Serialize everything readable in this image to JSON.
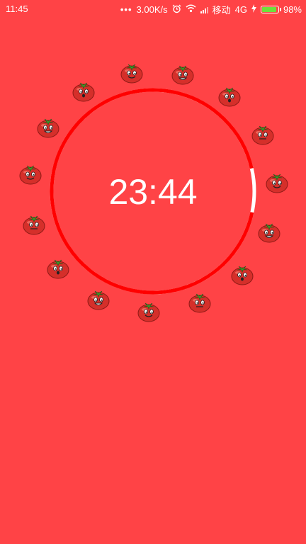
{
  "status_bar": {
    "time": "11:45",
    "network_speed": "3.00K/s",
    "carrier": "移动",
    "network_type": "4G",
    "battery_percent": "98%",
    "battery_level": 0.98,
    "icons": [
      "more-dots-icon",
      "alarm-icon",
      "wifi-icon",
      "signal-icon",
      "charging-icon",
      "battery-icon"
    ]
  },
  "timer": {
    "display": "23:44",
    "progress_remaining_fraction": 0.93
  },
  "tomatoes": {
    "count": 15,
    "icon": "tomato-face-icon"
  },
  "colors": {
    "background": "#ff4346",
    "ring": "#ff0000",
    "ring_remaining": "#ffffff",
    "text": "#ffffff"
  }
}
